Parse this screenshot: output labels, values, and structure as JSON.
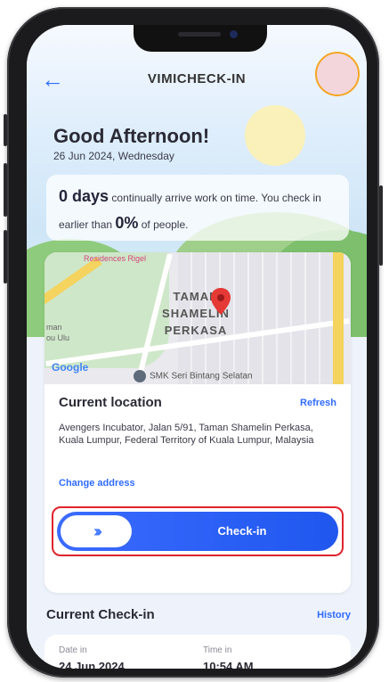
{
  "header": {
    "title": "VIMICHECK-IN",
    "back_icon": "←"
  },
  "greeting": {
    "title": "Good Afternoon!",
    "date": "26 Jun 2024, Wednesday"
  },
  "stats": {
    "days_value": "0 days",
    "days_text": "continually arrive work on time. You check in earlier than",
    "percent_value": "0%",
    "percent_text": "of people."
  },
  "map": {
    "label": "TAMAN SHAMELIN PERKASA",
    "place_top": "Residences Rigel",
    "side_text": "man\nou Ulu",
    "provider": "Google",
    "school": "SMK Seri Bintang Selatan"
  },
  "location": {
    "title": "Current location",
    "refresh_label": "Refresh",
    "address": "Avengers Incubator, Jalan 5/91, Taman Shamelin Perkasa, Kuala Lumpur, Federal Territory of Kuala Lumpur, Malaysia",
    "change_label": "Change address"
  },
  "checkin": {
    "knob_icon": "›››",
    "label": "Check-in"
  },
  "current_checkin": {
    "title": "Current Check-in",
    "history_label": "History",
    "date_label": "Date in",
    "date_value": "24 Jun 2024",
    "time_label": "Time in",
    "time_value": "10:54 AM"
  },
  "colors": {
    "accent": "#2f6bff",
    "highlight": "#e0232c",
    "avatar_ring": "#f5a623"
  }
}
